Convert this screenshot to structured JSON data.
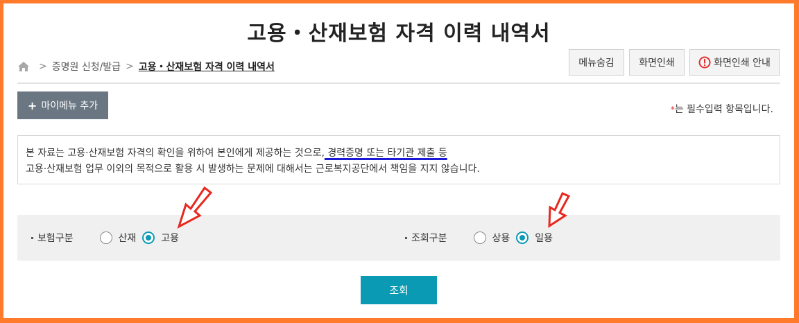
{
  "page": {
    "title": "고용・산재보험 자격 이력 내역서"
  },
  "breadcrumb": {
    "parent": "증명원 신청/발급",
    "current": "고용・산재보험 자격 이력 내역서"
  },
  "top_buttons": {
    "hide_menu": "메뉴숨김",
    "print": "화면인쇄",
    "print_guide": "화면인쇄 안내"
  },
  "mymenu_button": "마이메뉴 추가",
  "required_note": {
    "star": "*",
    "text": "는 필수입력 항목입니다."
  },
  "notice": {
    "line1_before": "본 자료는 고용·산재보험 자격의 확인을 위하여 본인에게 제공하는 것으로,",
    "line1_highlight": " 경력증명 또는 타기관 제출 등",
    "line2": "고용·산재보험 업무 이외의 목적으로 활용 시 발생하는 문제에 대해서는 근로복지공단에서 책임을 지지 않습니다."
  },
  "search": {
    "insurance": {
      "label": "보험구분",
      "options": [
        "산재",
        "고용"
      ],
      "selected": "고용"
    },
    "query": {
      "label": "조회구분",
      "options": [
        "상용",
        "일용"
      ],
      "selected": "일용"
    },
    "submit_label": "조회"
  },
  "colors": {
    "frame": "#ff7a2b",
    "accent": "#0b9ab3",
    "mymenu_button": "#6a7682",
    "annotation_arrow": "#e8281e"
  }
}
